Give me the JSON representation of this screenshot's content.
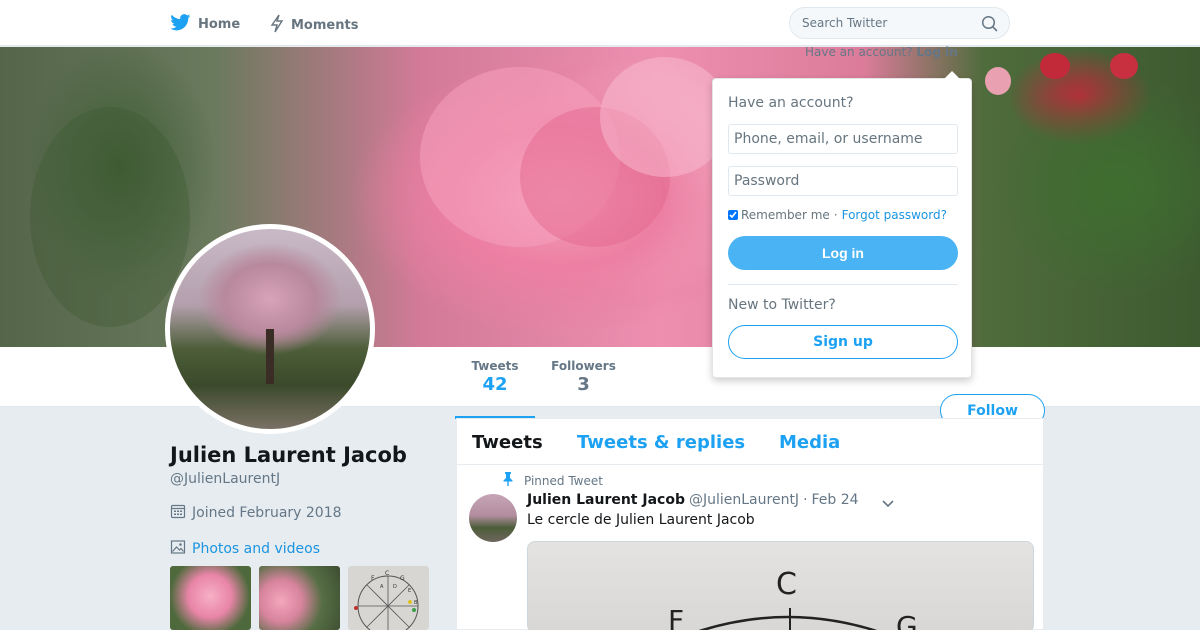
{
  "nav": {
    "home_label": "Home",
    "moments_label": "Moments",
    "search_placeholder": "Search Twitter"
  },
  "account_link": {
    "prompt": "Have an account?",
    "login": "Log in"
  },
  "login_dropdown": {
    "title": "Have an account?",
    "username_placeholder": "Phone, email, or username",
    "password_placeholder": "Password",
    "remember_label": "Remember me",
    "separator": "·",
    "forgot_label": "Forgot password?",
    "login_button": "Log in",
    "new_prompt": "New to Twitter?",
    "signup_button": "Sign up"
  },
  "profile": {
    "name": "Julien Laurent Jacob",
    "handle": "@JulienLaurentJ",
    "joined": "Joined February 2018",
    "photos_link": "Photos and videos",
    "follow_button": "Follow"
  },
  "stats": {
    "tweets_label": "Tweets",
    "tweets_value": "42",
    "followers_label": "Followers",
    "followers_value": "3"
  },
  "tabs": {
    "tweets": "Tweets",
    "replies": "Tweets & replies",
    "media": "Media"
  },
  "tweet": {
    "pinned_label": "Pinned Tweet",
    "name": "Julien Laurent Jacob",
    "handle": "@JulienLaurentJ",
    "separator": "·",
    "date": "Feb 24",
    "text": "Le cercle de Julien Laurent Jacob",
    "media_letters": [
      "C",
      "F",
      "G"
    ]
  },
  "thumbnail_letters": [
    "C",
    "F",
    "G",
    "D",
    "A",
    "E",
    "B"
  ],
  "colors": {
    "brand": "#1da1f2",
    "login_button": "#4ab3f4",
    "link": "#1b95e0",
    "muted": "#657786",
    "background": "#e6ecf0"
  },
  "icons": {
    "home": "twitter-bird-icon",
    "moments": "lightning-icon",
    "search": "search-icon",
    "joined": "calendar-icon",
    "photos": "image-icon",
    "pinned": "pin-icon",
    "caret": "chevron-down-icon"
  }
}
